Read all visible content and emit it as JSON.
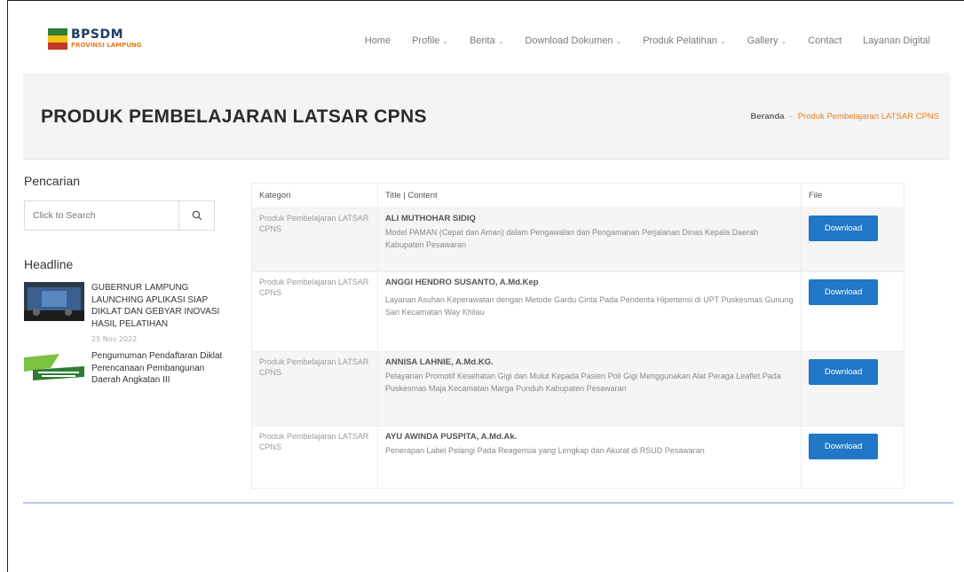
{
  "header": {
    "logo_title": "BPSDM",
    "logo_subtitle": "PROVINSI LAMPUNG",
    "nav": [
      {
        "label": "Home",
        "dropdown": false
      },
      {
        "label": "Profile",
        "dropdown": true
      },
      {
        "label": "Berita",
        "dropdown": true
      },
      {
        "label": "Download Dokumen",
        "dropdown": true
      },
      {
        "label": "Produk Pelatihan",
        "dropdown": true
      },
      {
        "label": "Gallery",
        "dropdown": true
      },
      {
        "label": "Contact",
        "dropdown": false
      },
      {
        "label": "Layanan Digital",
        "dropdown": false
      }
    ]
  },
  "page": {
    "title": "PRODUK PEMBELAJARAN LATSAR CPNS",
    "breadcrumb_home": "Beranda",
    "breadcrumb_sep": "-",
    "breadcrumb_current": "Produk Pembelajaran LATSAR CPNS"
  },
  "sidebar": {
    "search_heading": "Pencarian",
    "search_placeholder": "Click to Search",
    "headline_heading": "Headline",
    "news": [
      {
        "title": "GUBERNUR LAMPUNG LAUNCHING APLIKASI SIAP DIKLAT DAN GEBYAR INOVASI HASIL PELATIHAN",
        "date": "25 Nov 2022"
      },
      {
        "title": "Pengumuman Pendaftaran Diklat Perencanaan Pembangunan Daerah Angkatan III",
        "date": ""
      }
    ]
  },
  "table": {
    "headers": {
      "kategori": "Kategori",
      "title": "Title | Content",
      "file": "File"
    },
    "download_label": "Download",
    "rows": [
      {
        "kategori": "Produk Pembelajaran LATSAR CPNS",
        "title": "ALI MUTHOHAR SIDIQ",
        "content": "Model PAMAN (Cepat dan Aman) dalam Pengawalan dan Pengamanan Perjalanan Dinas Kepala Daerah Kabupaten Pesawaran"
      },
      {
        "kategori": "Produk Pembelajaran LATSAR CPNS",
        "title": "ANGGI HENDRO SUSANTO, A.Md.Kep",
        "content": "Layanan Asuhan Keperawatan dengan Metode Gardu Cinta Pada Penderita Hipertensi di UPT Puskesmas Gunung Sari Kecamatan Way Khilau"
      },
      {
        "kategori": "Produk Pembelajaran LATSAR CPNS",
        "title": "ANNISA LAHNIE, A.Md.KG.",
        "content": "Pelayanan Promotif Kesehatan Gigi dan Mulut Kepada Pasien Poli Gigi Menggunakan Alat Peraga Leaflet Pada Puskesmas Maja Kecamatan Marga Punduh Kabupaten Pesawaran"
      },
      {
        "kategori": "Produk Pembelajaran LATSAR CPNS",
        "title": "AYU AWINDA PUSPITA, A.Md.Ak.",
        "content": "Penerapan Label Pelangi Pada Reagensia yang Lengkap dan Akurat di RSUD Pesawaran"
      }
    ]
  }
}
